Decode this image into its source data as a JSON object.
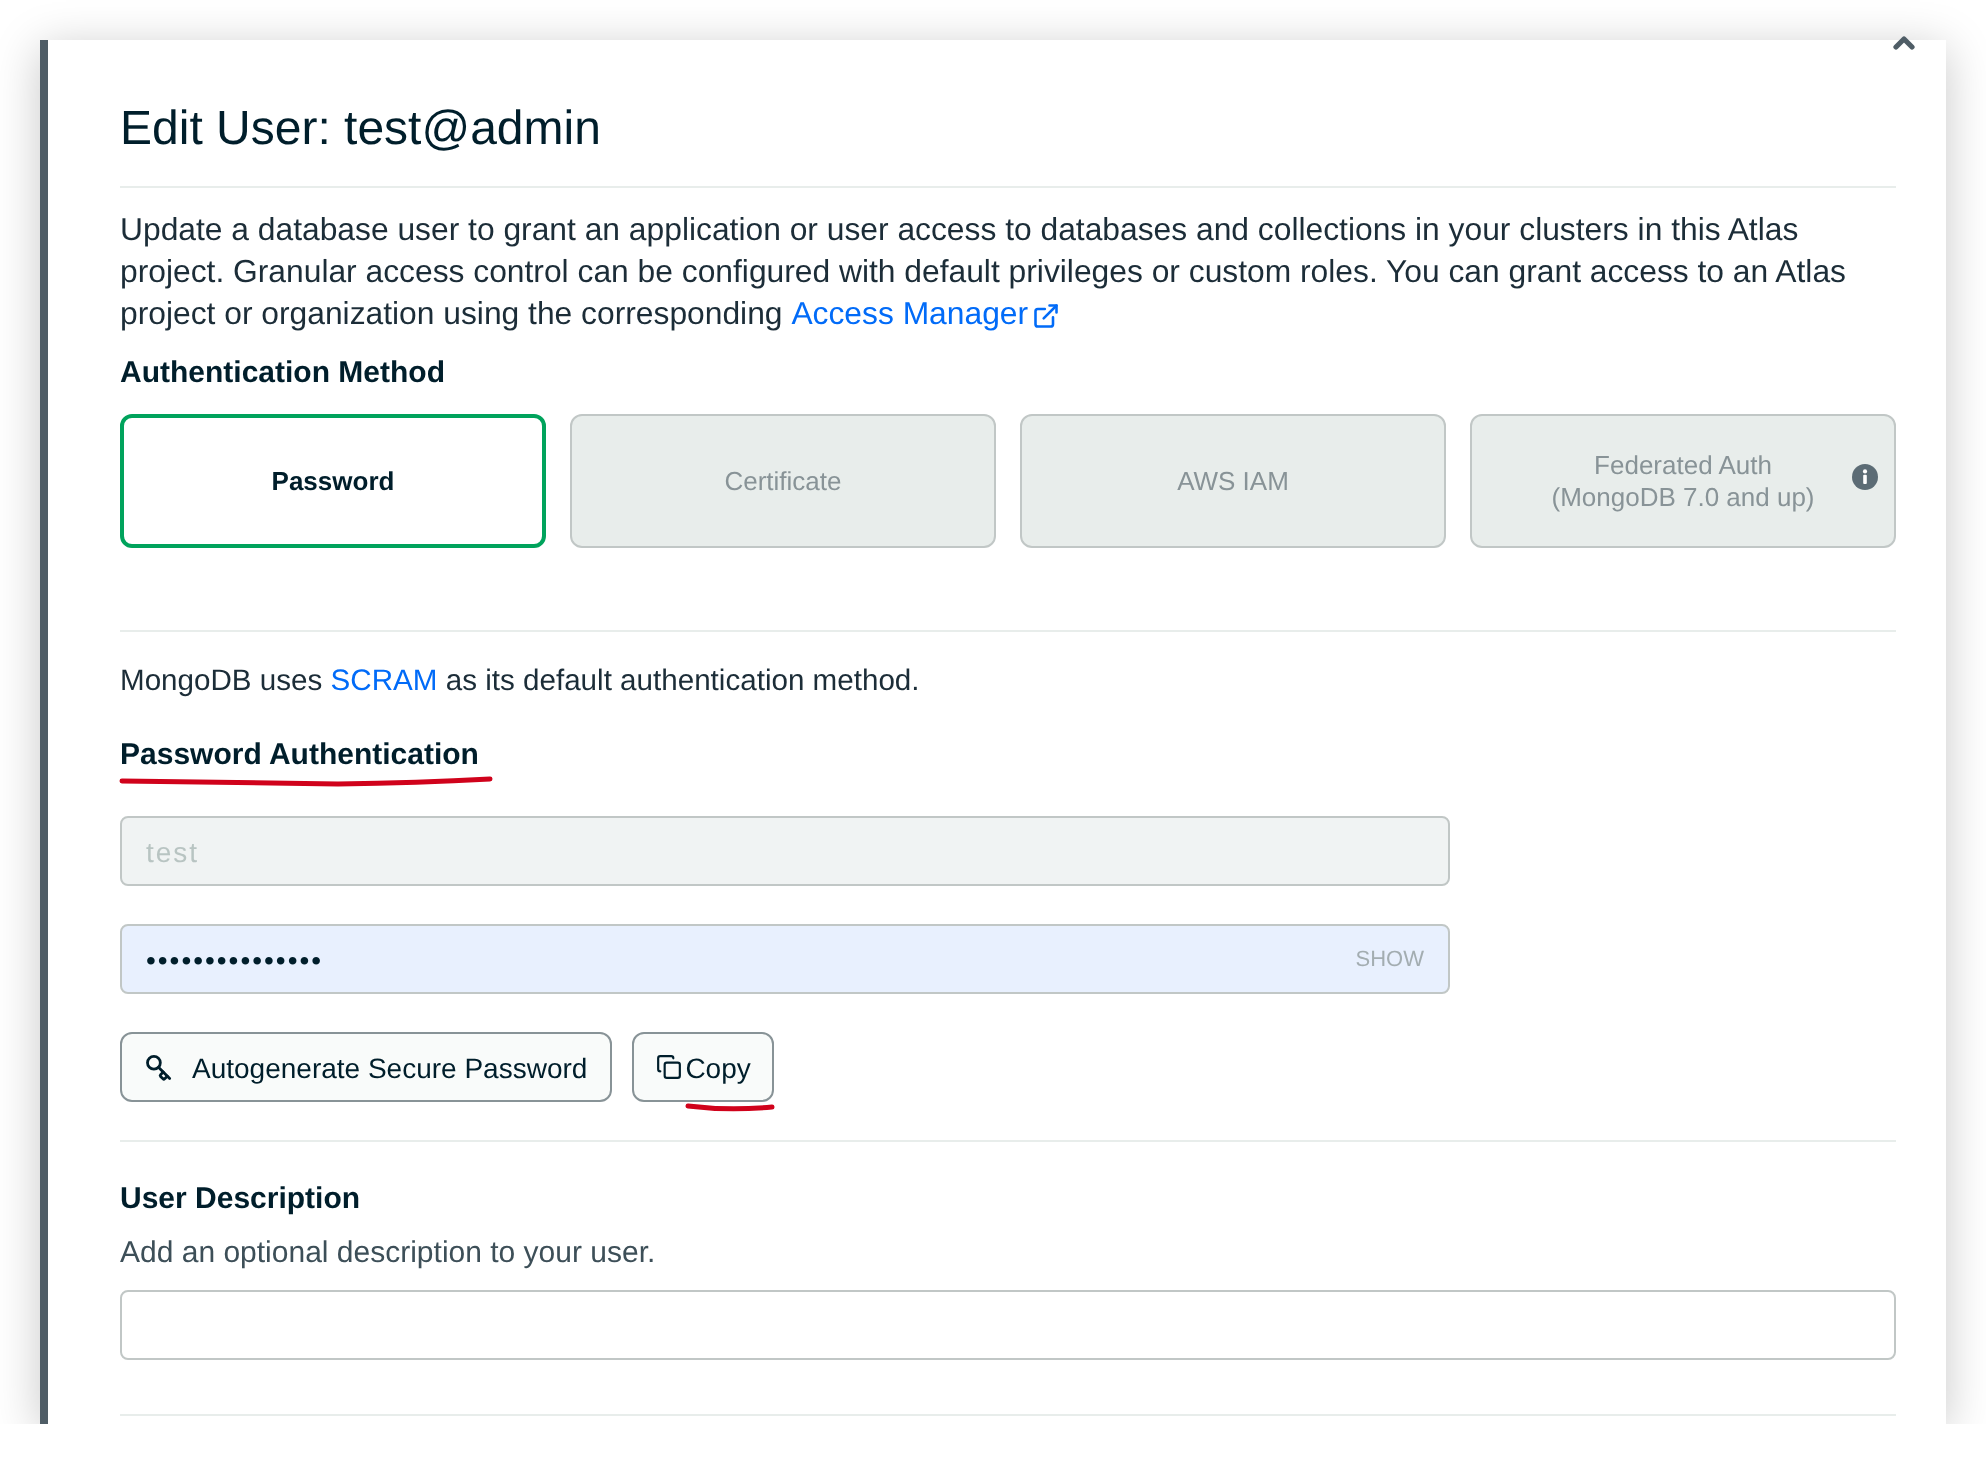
{
  "dialog": {
    "title": "Edit User: test@admin",
    "intro": "Update a database user to grant an application or user access to databases and collections in your clusters in this Atlas project. Granular access control can be configured with default privileges or custom roles. You can grant access to an Atlas project or organization using the corresponding",
    "intro_link": "Access Manager"
  },
  "auth_method": {
    "label": "Authentication Method",
    "options": [
      {
        "label": "Password",
        "selected": true,
        "info": false
      },
      {
        "label": "Certificate",
        "selected": false,
        "info": false
      },
      {
        "label": "AWS IAM",
        "selected": false,
        "info": false
      },
      {
        "label": "Federated Auth",
        "detail": "(MongoDB 7.0 and up)",
        "selected": false,
        "info": true
      }
    ]
  },
  "scram_note": {
    "before": "MongoDB uses",
    "link": "SCRAM",
    "after": "as its default authentication method."
  },
  "password_auth": {
    "heading": "Password Authentication",
    "marked": true,
    "username": {
      "value": "test",
      "disabled": true
    },
    "password": {
      "value": "•••••••••••••••",
      "autofilled": true,
      "toggle": "SHOW"
    },
    "buttons": [
      {
        "kind": "generate",
        "label": "Autogenerate Secure Password",
        "marked": false
      },
      {
        "kind": "copy",
        "label": "Copy",
        "marked": true
      }
    ]
  },
  "user_description": {
    "heading": "User Description",
    "hint": "Add an optional description to your user."
  }
}
